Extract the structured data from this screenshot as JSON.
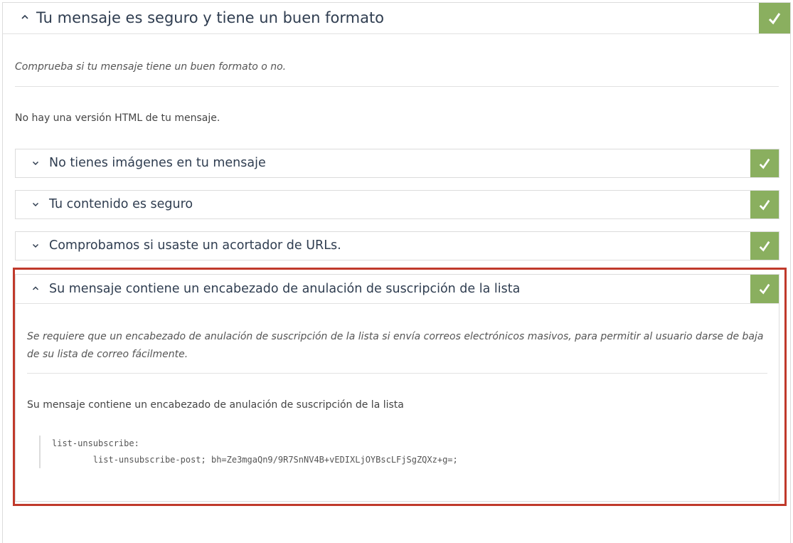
{
  "main": {
    "title": "Tu mensaje es seguro y tiene un buen formato",
    "description": "Comprueba si tu mensaje tiene un buen formato o no.",
    "body": "No hay una versión HTML de tu mensaje.",
    "status_icon": "check-icon"
  },
  "checks": [
    {
      "title": "No tienes imágenes en tu mensaje",
      "status_icon": "check-icon"
    },
    {
      "title": "Tu contenido es seguro",
      "status_icon": "check-icon"
    },
    {
      "title": "Comprobamos si usaste un acortador de URLs.",
      "status_icon": "check-icon"
    }
  ],
  "expanded": {
    "title": "Su mensaje contiene un encabezado de anulación de suscripción de la lista",
    "description": "Se requiere que un encabezado de anulación de suscripción de la lista si envía correos electrónicos masivos, para permitir al usuario darse de baja de su lista de correo fácilmente.",
    "body": "Su mensaje contiene un encabezado de anulación de suscripción de la lista",
    "code_line1": "list-unsubscribe:",
    "code_line2": "        list-unsubscribe-post; bh=Ze3mgaQn9/9R7SnNV4B+vEDIXLjOYBscLFjSgZQXz+g=;"
  },
  "colors": {
    "success": "#8aaf5f",
    "highlight": "#c0392b",
    "title": "#2f3d50"
  }
}
